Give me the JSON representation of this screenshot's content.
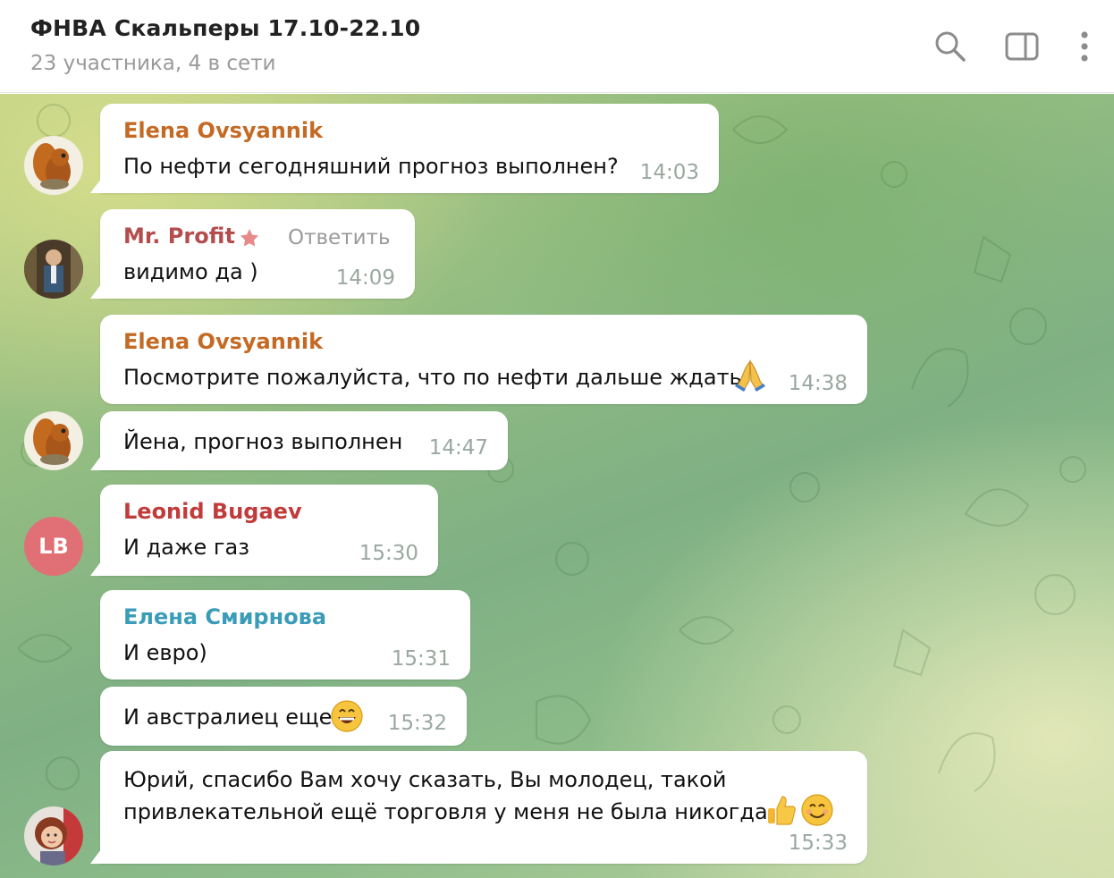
{
  "header": {
    "title": "ФНВА Скальперы 17.10-22.10",
    "subtitle": "23 участника, 4 в сети",
    "icons": [
      "search-icon",
      "sidebar-toggle-icon",
      "more-vertical-icon"
    ]
  },
  "colors": {
    "elena_ovsyannik": "#c46a25",
    "mr_profit": "#b44d4d",
    "leonid": "#c23b3b",
    "elena_smirnova": "#3a9cb8",
    "time": "#9aa8a0",
    "lb_avatar": "#e17076"
  },
  "messages": [
    {
      "sender": "Elena Ovsyannik",
      "text": "По нефти сегодняшний прогноз выполнен?",
      "time": "14:03"
    },
    {
      "sender": "Mr. Profit",
      "reply_label": "Ответить",
      "text": "видимо да )",
      "time": "14:09"
    },
    {
      "sender": "Elena Ovsyannik",
      "text": "Посмотрите пожалуйста, что по нефти дальше ждать",
      "emoji": "folded-hands-emoji",
      "time": "14:38"
    },
    {
      "text": "Йена, прогноз выполнен",
      "time": "14:47"
    },
    {
      "sender": "Leonid Bugaev",
      "avatar_initials": "LB",
      "text": "И даже газ",
      "time": "15:30"
    },
    {
      "sender": "Елена Смирнова",
      "text": "И евро)",
      "time": "15:31"
    },
    {
      "text": "И австралиец еще",
      "emoji": "grinning-emoji",
      "time": "15:32"
    },
    {
      "text_line1": "Юрий, спасибо Вам хочу сказать, Вы молодец, такой",
      "text_line2": "привлекательной ещё торговля у меня не была никогда",
      "emojis": [
        "thumbs-up-emoji",
        "smiling-emoji"
      ],
      "time": "15:33"
    }
  ]
}
